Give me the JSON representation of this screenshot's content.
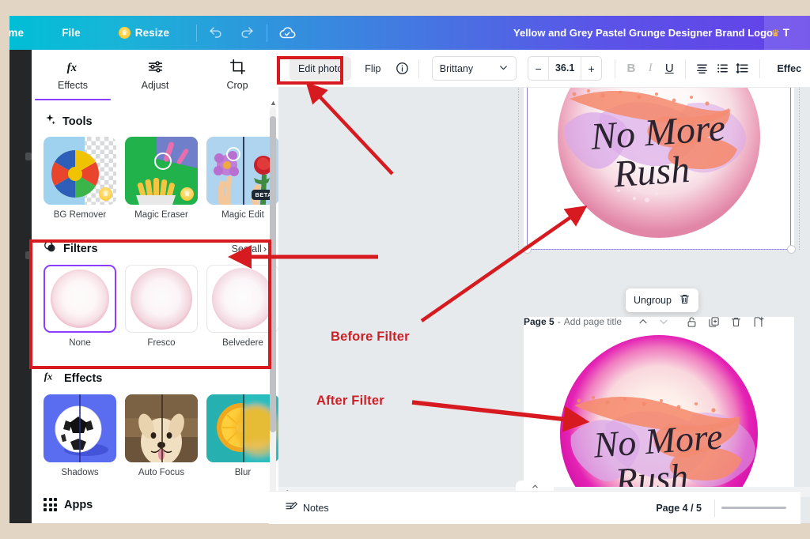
{
  "app": {
    "title": "Yellow and Grey Pastel Grunge Designer Brand Logo",
    "try_label": "T",
    "nav": {
      "home": "ome",
      "file": "File",
      "resize": "Resize",
      "undo_icon": "undo-icon",
      "redo_icon": "redo-icon",
      "cloud_icon": "cloud-check-icon"
    }
  },
  "left_panel": {
    "tabs": [
      {
        "label": "Effects",
        "icon": "fx-icon",
        "active": true
      },
      {
        "label": "Adjust",
        "icon": "sliders-icon",
        "active": false
      },
      {
        "label": "Crop",
        "icon": "crop-icon",
        "active": false
      }
    ],
    "tools_section": {
      "title": "Tools",
      "icon": "sparkle-icon",
      "items": [
        {
          "label": "BG Remover",
          "badge": "pin"
        },
        {
          "label": "Magic Eraser",
          "badge": "pin"
        },
        {
          "label": "Magic Edit",
          "badge": "BETA"
        }
      ]
    },
    "filters_section": {
      "title": "Filters",
      "icon": "filters-icon",
      "see_all": "See all",
      "items": [
        {
          "label": "None",
          "selected": true
        },
        {
          "label": "Fresco",
          "selected": false
        },
        {
          "label": "Belvedere",
          "selected": false
        }
      ]
    },
    "effects_section": {
      "title": "Effects",
      "icon": "fx-icon",
      "items": [
        {
          "label": "Shadows"
        },
        {
          "label": "Auto Focus"
        },
        {
          "label": "Blur"
        }
      ]
    },
    "apps_section": {
      "title": "Apps",
      "icon": "grid-icon"
    }
  },
  "toolbar": {
    "edit_photo": "Edit photo",
    "flip": "Flip",
    "info_icon": "info-icon",
    "font_name": "Brittany",
    "font_chevron": "chevron-down-icon",
    "size_minus": "−",
    "size_value": "36.1",
    "size_plus": "+",
    "bold": "B",
    "italic": "I",
    "underline": "U",
    "align_icon": "text-align-icon",
    "list_icon": "bullet-list-icon",
    "spacing_icon": "line-spacing-icon",
    "effects": "Effec"
  },
  "canvas": {
    "logo_text_line1": "No More",
    "logo_text_line2": "Rush",
    "ungroup": {
      "label": "Ungroup",
      "icon": "trash-icon"
    },
    "page5": {
      "page_label": "Page 5",
      "separator": "-",
      "title_placeholder": "Add page title",
      "icons": [
        "chevron-up-icon",
        "chevron-down-icon",
        "lock-icon",
        "duplicate-icon",
        "trash-icon",
        "add-page-icon"
      ]
    }
  },
  "bottom_bar": {
    "notes": "Notes",
    "notes_icon": "notes-icon",
    "page_count": "Page 4 / 5",
    "collapse_icon": "chevron-up-icon"
  },
  "annotations": [
    {
      "label": "Before Filter"
    },
    {
      "label": "After Filter"
    }
  ],
  "colors": {
    "annotation_red": "#cc2027",
    "highlight_box_red": "#d71920",
    "accent_purple": "#8b3dff",
    "nav_cyan": "#00bed6",
    "nav_blue": "#6441e9",
    "page_bg": "#e7eaec",
    "outer_bg": "#e2d5c3"
  }
}
